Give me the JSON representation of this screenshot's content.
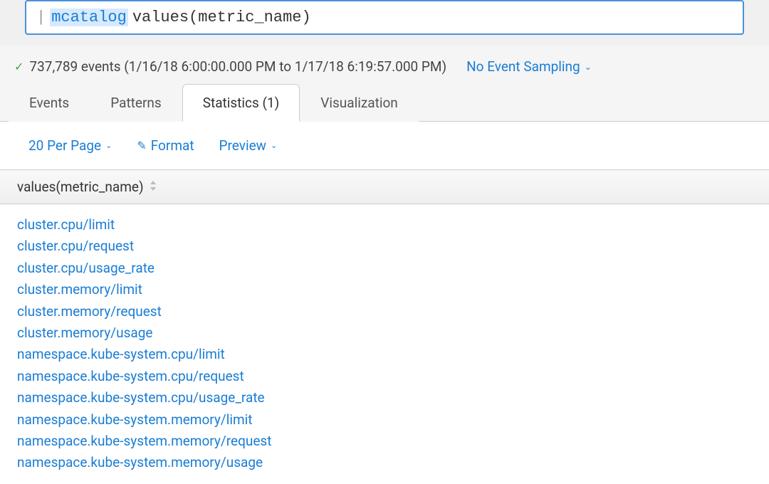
{
  "search": {
    "pipe": "|",
    "keyword": "mcatalog",
    "rest": "values(metric_name)"
  },
  "status": {
    "events_text": "737,789 events (1/16/18 6:00:00.000 PM to 1/17/18 6:19:57.000 PM)",
    "sampling_label": "No Event Sampling"
  },
  "tabs": [
    {
      "label": "Events",
      "active": false
    },
    {
      "label": "Patterns",
      "active": false
    },
    {
      "label": "Statistics (1)",
      "active": true
    },
    {
      "label": "Visualization",
      "active": false
    }
  ],
  "toolbar": {
    "per_page_label": "20 Per Page",
    "format_label": "Format",
    "preview_label": "Preview"
  },
  "table": {
    "header": "values(metric_name)"
  },
  "results": [
    "cluster.cpu/limit",
    "cluster.cpu/request",
    "cluster.cpu/usage_rate",
    "cluster.memory/limit",
    "cluster.memory/request",
    "cluster.memory/usage",
    "namespace.kube-system.cpu/limit",
    "namespace.kube-system.cpu/request",
    "namespace.kube-system.cpu/usage_rate",
    "namespace.kube-system.memory/limit",
    "namespace.kube-system.memory/request",
    "namespace.kube-system.memory/usage"
  ]
}
